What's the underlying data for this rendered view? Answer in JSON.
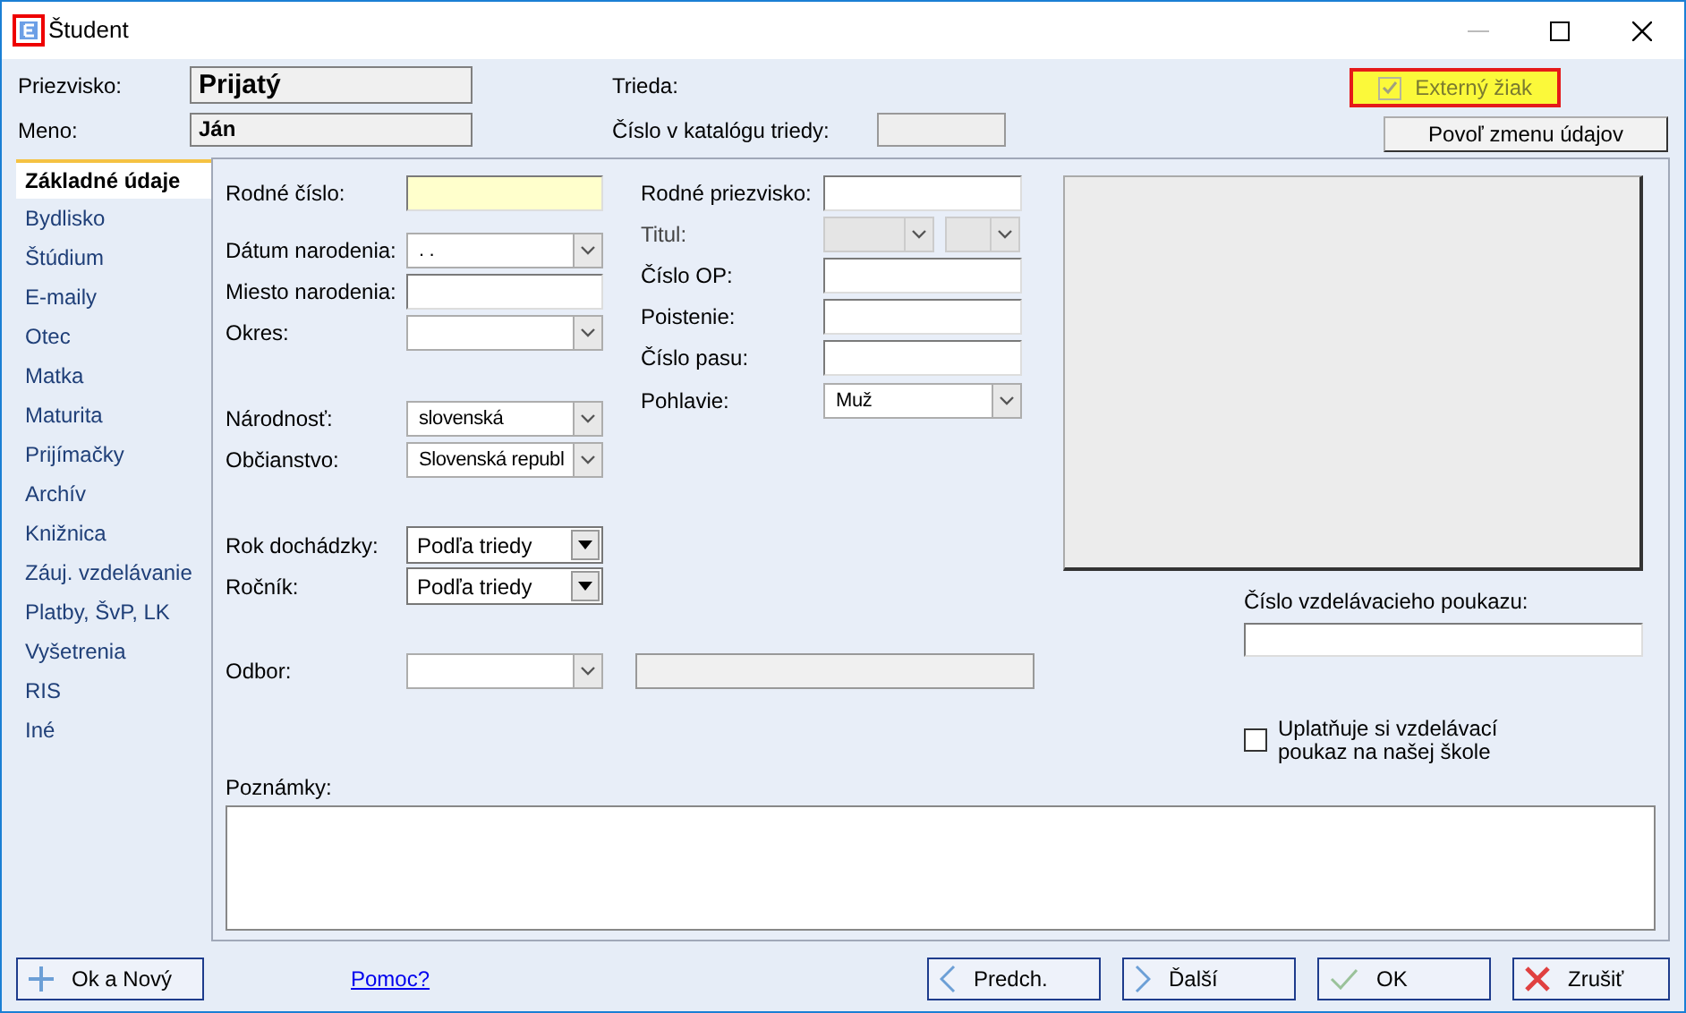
{
  "window": {
    "title": "Študent"
  },
  "header": {
    "surname": {
      "label": "Priezvisko:",
      "value": "Prijatý"
    },
    "name": {
      "label": "Meno:",
      "value": "Ján"
    },
    "class_label": "Trieda:",
    "catalog": {
      "label": "Číslo v katalógu triedy:",
      "disabled": true
    },
    "external": {
      "label": "Externý žiak",
      "checked": true,
      "disabled": true
    },
    "unlock_button": "Povoľ zmenu údajov"
  },
  "sidebar": {
    "items": [
      {
        "label": "Základné údaje",
        "selected": true
      },
      {
        "label": "Bydlisko",
        "selected": false
      },
      {
        "label": "Štúdium",
        "selected": false
      },
      {
        "label": "E-maily",
        "selected": false
      },
      {
        "label": "Otec",
        "selected": false
      },
      {
        "label": "Matka",
        "selected": false
      },
      {
        "label": "Maturita",
        "selected": false
      },
      {
        "label": "Prijímačky",
        "selected": false
      },
      {
        "label": "Archív",
        "selected": false
      },
      {
        "label": "Knižnica",
        "selected": false
      },
      {
        "label": "Záuj. vzdelávanie",
        "selected": false
      },
      {
        "label": "Platby, ŠvP, LK",
        "selected": false
      },
      {
        "label": "Vyšetrenia",
        "selected": false
      },
      {
        "label": "RIS",
        "selected": false
      },
      {
        "label": "Iné",
        "selected": false
      }
    ]
  },
  "left_groups": [
    [
      {
        "label": "Rodné číslo:",
        "kind": "text",
        "highlighted": true
      }
    ],
    [
      {
        "label": "Dátum narodenia:",
        "kind": "combo",
        "value": ".    ."
      },
      {
        "label": "Miesto narodenia:",
        "kind": "text"
      },
      {
        "label": "Okres:",
        "kind": "combo"
      }
    ],
    [
      {
        "label": "Národnosť:",
        "kind": "combo",
        "value": "slovenská"
      },
      {
        "label": "Občianstvo:",
        "kind": "combo",
        "value": "Slovenská republ"
      }
    ],
    [
      {
        "label": "Rok dochádzky:",
        "kind": "dropdown",
        "value": "Podľa triedy"
      },
      {
        "label": "Ročník:",
        "kind": "dropdown",
        "value": "Podľa triedy"
      }
    ],
    [
      {
        "label": "Odbor:",
        "kind": "combo_extra"
      }
    ]
  ],
  "right_fields": [
    {
      "label": "Rodné priezvisko:",
      "kind": "text"
    },
    {
      "label": "Titul:",
      "kind": "combo_pair",
      "disabled": true
    },
    {
      "label": "Číslo OP:",
      "kind": "text"
    },
    {
      "label": "Poistenie:",
      "kind": "text"
    },
    {
      "label": "Číslo pasu:",
      "kind": "text"
    },
    {
      "label": "Pohlavie:",
      "kind": "combo",
      "value": "Muž"
    }
  ],
  "voucher": {
    "label": "Číslo vzdelávacieho poukazu:",
    "checkbox_label": "Uplatňuje si vzdelávací poukaz na našej škole",
    "checked": false
  },
  "notes": {
    "label": "Poznámky:"
  },
  "buttons": {
    "ok_new": "Ok a Nový",
    "help": "Pomoc?",
    "prev": "Predch.",
    "next": "Ďalší",
    "ok": "OK",
    "cancel": "Zrušiť"
  }
}
